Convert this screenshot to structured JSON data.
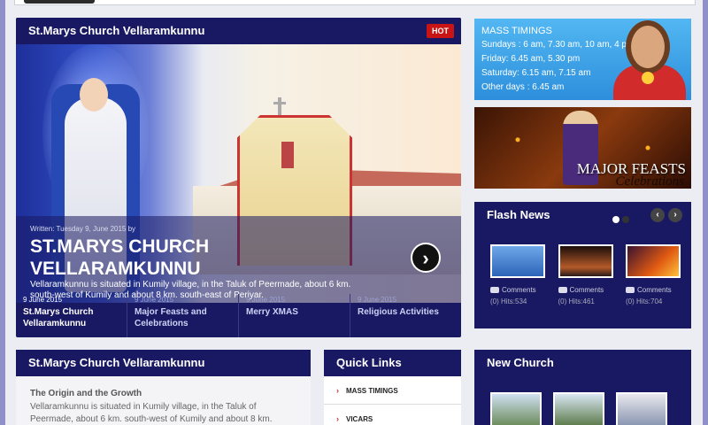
{
  "slider": {
    "title": "St.Marys Church Vellaramkunnu",
    "badge": "HOT",
    "meta": "Written: Tuesday 9, June 2015 by",
    "heading": "ST.MARYS CHURCH VELLARAMKUNNU",
    "text": "Vellaramkunnu is situated in Kumily village, in the Taluk of Peermade, about 6 km. south-west of Kumily and about 8 km. south-east of Periyar.",
    "tabs": [
      {
        "date": "9 June 2015",
        "title": "St.Marys Church Vellaramkunnu"
      },
      {
        "date": "9 June 2015",
        "title": "Major Feasts and Celebrations"
      },
      {
        "date": "9 June 2015",
        "title": "Merry XMAS"
      },
      {
        "date": "9 June 2015",
        "title": "Religious Activities"
      }
    ]
  },
  "mass": {
    "heading": "MASS TIMINGS",
    "lines": [
      "Sundays : 6 am, 7.30 am, 10 am, 4 pm",
      "Friday: 6.45 am, 5.30 pm",
      "Saturday: 6.15 am, 7.15 am",
      "Other days : 6.45 am"
    ]
  },
  "feasts": {
    "line1": "MAJOR FEASTS",
    "line2": "Celebrations"
  },
  "flash": {
    "title": "Flash News",
    "items": [
      {
        "comments": "Comments",
        "count": "(0)",
        "hits": "Hits:534"
      },
      {
        "comments": "Comments",
        "count": "(0)",
        "hits": "Hits:461"
      },
      {
        "comments": "Comments",
        "count": "(0)",
        "hits": "Hits:704"
      }
    ]
  },
  "about": {
    "title": "St.Marys Church Vellaramkunnu",
    "sub": "The Origin and the Growth",
    "text": "Vellaramkunnu is situated in Kumily village, in the Taluk of Peermade, about 6 km. south-west of Kumily and about 8 km."
  },
  "quick": {
    "title": "Quick Links",
    "items": [
      "MASS TIMINGS",
      "VICARS"
    ]
  },
  "newchurch": {
    "title": "New Church"
  }
}
